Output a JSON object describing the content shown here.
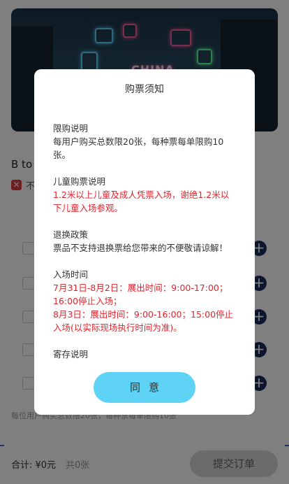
{
  "page": {
    "event_title": "B to",
    "badge_text": "不",
    "limit_text": "每位用户购买总数限20张，每种票每单限购10张",
    "footer": {
      "total_label": "合计: ¥0元",
      "count_label": "共0张",
      "submit_label": "提交订单"
    },
    "ticket_rows": [
      {
        "add_icon": "plus-icon"
      },
      {
        "add_icon": "plus-icon"
      },
      {
        "add_icon": "plus-icon"
      },
      {
        "add_icon": "plus-icon"
      },
      {
        "add_icon": "plus-icon"
      }
    ],
    "banner_text": "CHINA"
  },
  "modal": {
    "title": "购票须知",
    "sections": [
      {
        "heading": "限购说明",
        "lines": [
          "每用户购买总数限20张，每种票每单限购10张。"
        ],
        "red": false
      },
      {
        "heading": "儿童购票说明",
        "lines": [
          "1.2米以上儿童及成人凭票入场，谢绝1.2米以下儿童入场参观。"
        ],
        "red": true
      },
      {
        "heading": "退换政策",
        "lines": [
          "票品不支持退换票给您带来的不便敬请谅解！"
        ],
        "red": false
      },
      {
        "heading": "入场时间",
        "lines": [
          "7月31日-8月2日：展出时间：9:00-17:00；16:00停止入场；",
          "8月3日：展出时间：9:00-16:00；15:00停止入场(以实际现场执行时间为准)。"
        ],
        "red": true
      },
      {
        "heading": "寄存说明",
        "lines": [],
        "red": false
      }
    ],
    "agree_label": "同意"
  },
  "colors": {
    "accent_button": "#5fd3f5",
    "warning_text": "#e8222b",
    "plus_button": "#1d2a5c"
  }
}
